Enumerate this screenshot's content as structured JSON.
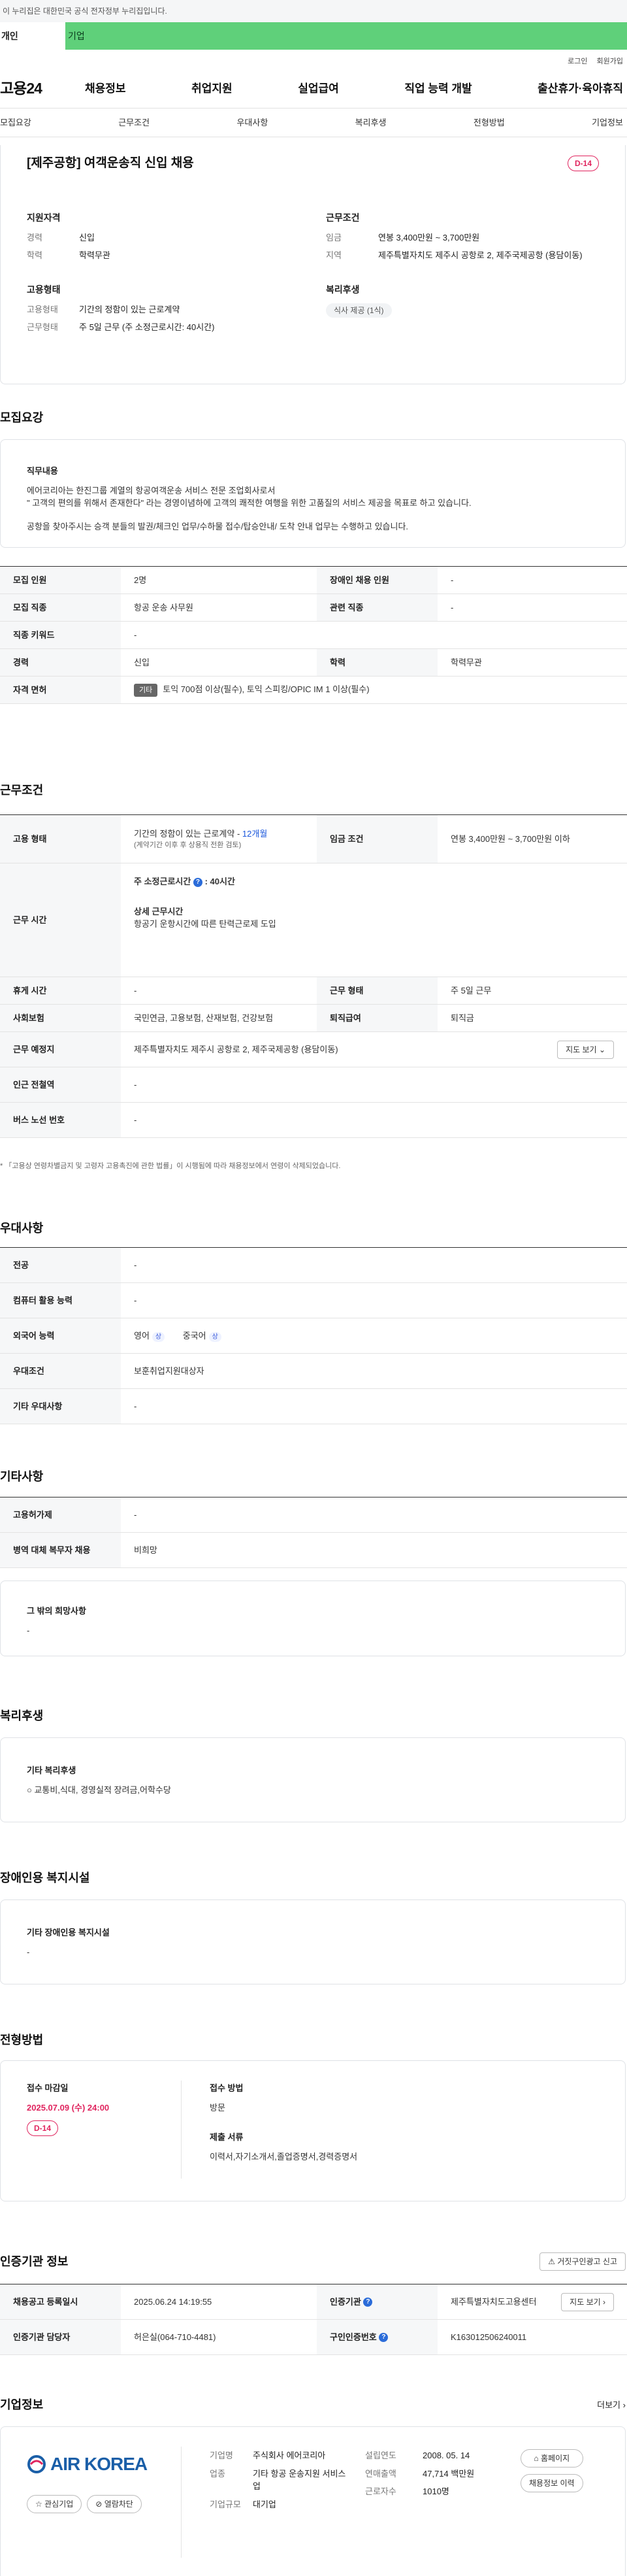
{
  "gov_banner": "이 누리집은 대한민국 공식 전자정부 누리집입니다.",
  "top_tabs": {
    "personal": "개인",
    "company": "기업"
  },
  "util": {
    "login": "로그인",
    "join": "회원가입"
  },
  "logo": "고용24",
  "gnb": [
    "채용정보",
    "취업지원",
    "실업급여",
    "직업 능력 개발",
    "출산휴가·육아휴직"
  ],
  "subtabs": [
    "모집요강",
    "근무조건",
    "우대사항",
    "복리후생",
    "전형방법",
    "기업정보"
  ],
  "hero": {
    "title": "[제주공항] 여객운송직 신입 채용",
    "dday": "D-14",
    "qual_title": "지원자격",
    "qual": [
      {
        "k": "경력",
        "v": "신입"
      },
      {
        "k": "학력",
        "v": "학력무관"
      }
    ],
    "cond_title": "근무조건",
    "cond": [
      {
        "k": "임금",
        "v": "연봉 3,400만원 ~ 3,700만원"
      },
      {
        "k": "지역",
        "v": "제주특별자치도 제주시 공항로 2, 제주국제공항 (용담이동)"
      }
    ],
    "emp_title": "고용형태",
    "emp": [
      {
        "k": "고용형태",
        "v": "기간의 정함이 있는 근로계약"
      },
      {
        "k": "근무형태",
        "v": "주 5일 근무 (주 소정근로시간: 40시간)"
      }
    ],
    "welfare_title": "복리후생",
    "welfare_chip": "식사 제공 (1식)"
  },
  "recruit": {
    "title": "모집요강",
    "duty_title": "직무내용",
    "duty_lines": [
      "에어코리아는 한진그룹 계열의 항공여객운송 서비스 전문 조업회사로서",
      "\" 고객의 편의를 위해서 존재한다\" 라는 경영이념하에 고객의 쾌적한 여행을 위한 고품질의 서비스 제공을 목표로 하고 있습니다.",
      "공항을 찾아주시는 승객 분들의 발권/체크인 업무/수하물 접수/탑승안내/ 도착 안내 업무는 수행하고 있습니다."
    ],
    "rows": {
      "headcount_k": "모집 인원",
      "headcount_v": "2명",
      "disabled_k": "장애인 채용 인원",
      "disabled_v": "-",
      "job_k": "모집 직종",
      "job_v": "항공 운송 사무원",
      "related_k": "관련 직종",
      "related_v": "-",
      "keyword_k": "직종 키워드",
      "keyword_v": "-",
      "career_k": "경력",
      "career_v": "신입",
      "edu_k": "학력",
      "edu_v": "학력무관",
      "license_k": "자격 면허",
      "license_tag": "기타",
      "license_v": "토익 700점 이상(필수), 토익 스피킹/OPIC IM 1 이상(필수)"
    }
  },
  "workcond": {
    "title": "근무조건",
    "emp_k": "고용 형태",
    "emp_v1": "기간의 정함이 있는 근로계약 - ",
    "emp_v1b": "12개월",
    "emp_v2": "(계약기간 이후 후 상용직 전환 검토)",
    "wage_k": "임금 조건",
    "wage_v": "연봉 3,400만원 ~ 3,700만원 이하",
    "hours_k": "근무 시간",
    "hours_v": "-",
    "hours_week": "주 소정근로시간",
    "hours_week_v": "40시간",
    "hours_detail_t": "상세 근무시간",
    "hours_detail_v": "항공기 운항시간에 따른 탄력근로제 도입",
    "rest_k": "휴게 시간",
    "rest_v": "-",
    "type_k": "근무 형태",
    "type_v": "주 5일 근무",
    "ins_k": "사회보험",
    "ins_v": "국민연금, 고용보험, 산재보험, 건강보험",
    "retire_k": "퇴직급여",
    "retire_v": "퇴직금",
    "place_k": "근무 예정지",
    "place_v": "제주특별자치도 제주시 공항로 2, 제주국제공항 (용담이동)",
    "map_btn": "지도 보기",
    "subway_k": "인근 전철역",
    "subway_v": "-",
    "bus_k": "버스 노선 번호",
    "bus_v": "-",
    "note": "* 「고용상 연령차별금지 및 고령자 고용촉진에 관한 법률」이 시행됨에 따라 채용정보에서 연령이 삭제되었습니다."
  },
  "pref": {
    "title": "우대사항",
    "major_k": "전공",
    "major_v": "-",
    "pc_k": "컴퓨터 활용 능력",
    "pc_v": "-",
    "lang_k": "외국어 능력",
    "lang": [
      {
        "name": "영어",
        "level": "상"
      },
      {
        "name": "중국어",
        "level": "상"
      }
    ],
    "cond_k": "우대조건",
    "cond_v": "보훈취업지원대상자",
    "etc_k": "기타 우대사항",
    "etc_v": "-"
  },
  "other": {
    "title": "기타사항",
    "emp_k": "고용허가제",
    "emp_v": "-",
    "mil_k": "병역 대체 복무자 채용",
    "mil_v": "비희망",
    "wish_t": "그 밖의 희망사항",
    "wish_v": "-"
  },
  "welfare": {
    "title": "복리후생",
    "box_t": "기타 복리후생",
    "box_v": "○ 교통비,식대, 경영실적 장려금,어학수당"
  },
  "disab": {
    "title": "장애인용 복지시설",
    "box_t": "기타 장애인용 복지시설",
    "box_v": "-"
  },
  "process": {
    "title": "전형방법",
    "deadline_t": "접수 마감일",
    "deadline_v": "2025.07.09 (수) 24:00",
    "dday": "D-14",
    "method_t": "접수 방법",
    "method_v": "방문",
    "docs_t": "제출 서류",
    "docs_v": "이력서,자기소개서,졸업증명서,경력증명서"
  },
  "agency": {
    "title": "인증기관 정보",
    "report_btn": "거짓구인광고 신고",
    "reg_k": "채용공고 등록일시",
    "reg_v": "2025.06.24 14:19:55",
    "org_k": "인증기관",
    "org_v": "제주특별자치도고용센터",
    "map_btn": "지도 보기",
    "mgr_k": "인증기관 담당자",
    "mgr_v": "허은실(064-710-4481)",
    "no_k": "구인인증번호",
    "no_v": "K163012506240011"
  },
  "company": {
    "title": "기업정보",
    "more": "더보기",
    "logo_text": "AIR KOREA",
    "fav_btn": "관심기업",
    "block_btn": "열람차단",
    "name_k": "기업명",
    "name_v": "주식회사 에어코리아",
    "ind_k": "업종",
    "ind_v": "기타 항공 운송지원 서비스업",
    "size_k": "기업규모",
    "size_v": "대기업",
    "year_k": "설립연도",
    "year_v": "2008. 05. 14",
    "sales_k": "연매출액",
    "sales_v": "47,714 백만원",
    "emp_k": "근로자수",
    "emp_v": "1010명",
    "home_btn": "홈페이지",
    "hist_btn": "채용정보 이력"
  },
  "colors": {
    "accent_green": "#5fd07a",
    "red": "#e0245e",
    "blue": "#1a56db",
    "logo_blue": "#1b5fa8"
  }
}
